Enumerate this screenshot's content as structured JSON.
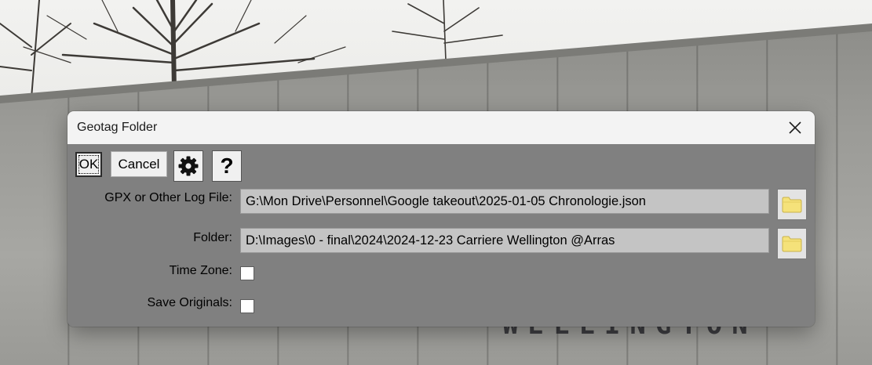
{
  "background": {
    "wall_text": "WELLINGTON"
  },
  "dialog": {
    "title": "Geotag Folder",
    "close_glyph": "✕",
    "toolbar": {
      "ok_label": "OK",
      "cancel_label": "Cancel",
      "settings_icon": "gear-icon",
      "help_label": "?"
    },
    "fields": {
      "log_file": {
        "label": "GPX or Other Log File:",
        "value": "G:\\Mon Drive\\Personnel\\Google takeout\\2025-01-05 Chronologie.json"
      },
      "folder": {
        "label": "Folder:",
        "value": "D:\\Images\\0 - final\\2024\\2024-12-23 Carriere Wellington @Arras"
      },
      "time_zone": {
        "label": "Time Zone:",
        "checked": false
      },
      "save_originals": {
        "label": "Save Originals:",
        "checked": false
      }
    },
    "colors": {
      "client_bg": "#808080",
      "titlebar_bg": "#f3f3f3",
      "field_bg": "#c4c4c4",
      "folder_icon": "#f5e27a"
    }
  }
}
